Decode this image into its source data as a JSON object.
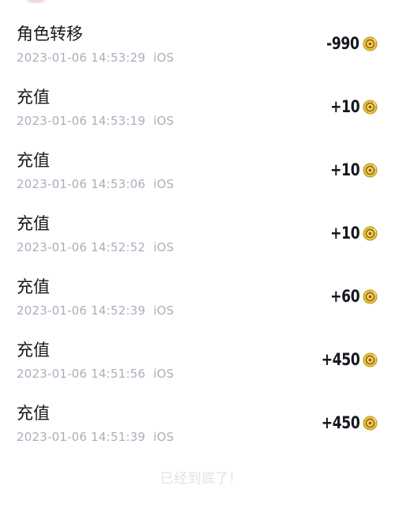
{
  "transactions": [
    {
      "title": "角色转移",
      "timestamp": "2023-01-06 14:53:29",
      "platform": "iOS",
      "amount": "-990"
    },
    {
      "title": "充值",
      "timestamp": "2023-01-06 14:53:19",
      "platform": "iOS",
      "amount": "+10"
    },
    {
      "title": "充值",
      "timestamp": "2023-01-06 14:53:06",
      "platform": "iOS",
      "amount": "+10"
    },
    {
      "title": "充值",
      "timestamp": "2023-01-06 14:52:52",
      "platform": "iOS",
      "amount": "+10"
    },
    {
      "title": "充值",
      "timestamp": "2023-01-06 14:52:39",
      "platform": "iOS",
      "amount": "+60"
    },
    {
      "title": "充值",
      "timestamp": "2023-01-06 14:51:56",
      "platform": "iOS",
      "amount": "+450"
    },
    {
      "title": "充值",
      "timestamp": "2023-01-06 14:51:39",
      "platform": "iOS",
      "amount": "+450"
    }
  ],
  "footer": {
    "end_text": "已经到底了!"
  },
  "icons": {
    "currency": "coin-icon"
  },
  "colors": {
    "title_text": "#15181f",
    "meta_text": "#a9b0bb",
    "footer_text": "#dfe3e8",
    "coin_gold": "#e8c23a",
    "coin_brown": "#8a5a12"
  }
}
